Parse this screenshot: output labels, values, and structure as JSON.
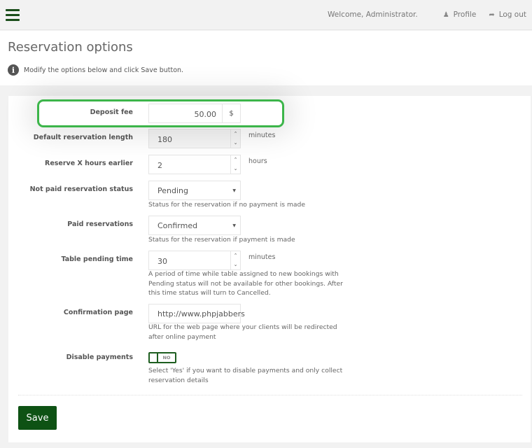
{
  "header": {
    "menu_icon": "hamburger-menu-icon",
    "welcome_text": "Welcome, Administrator.",
    "profile_label": "Profile",
    "profile_icon": "user-icon",
    "logout_label": "Log out",
    "logout_icon": "sign-out-icon"
  },
  "page": {
    "title": "Reservation options",
    "info_icon": "info-circle-icon",
    "info_text": "Modify the options below and click Save button."
  },
  "colors": {
    "brand_green": "#0e5214",
    "highlight_green": "#3cb54a"
  },
  "form": {
    "deposit_fee": {
      "label": "Deposit fee",
      "value": "50.00",
      "addon": "$",
      "highlighted": true
    },
    "default_length": {
      "label": "Default reservation length",
      "value": "180",
      "unit": "minutes",
      "disabled": true
    },
    "reserve_earlier": {
      "label": "Reserve X hours earlier",
      "value": "2",
      "unit": "hours"
    },
    "not_paid_status": {
      "label": "Not paid reservation status",
      "value": "Pending",
      "help": "Status for the reservation if no payment is made"
    },
    "paid_status": {
      "label": "Paid reservations",
      "value": "Confirmed",
      "help": "Status for the reservation if payment is made"
    },
    "pending_time": {
      "label": "Table pending time",
      "value": "30",
      "unit": "minutes",
      "help": "A period of time while table assigned to new bookings with Pending status will not be available for other bookings. After this time status will turn to Cancelled."
    },
    "confirmation_page": {
      "label": "Confirmation page",
      "value": "http://www.phpjabbers",
      "help": "URL for the web page where your clients will be redirected after online payment"
    },
    "disable_payments": {
      "label": "Disable payments",
      "state": "NO",
      "help": "Select 'Yes' if you want to disable payments and only collect reservation details"
    },
    "save_label": "Save"
  }
}
